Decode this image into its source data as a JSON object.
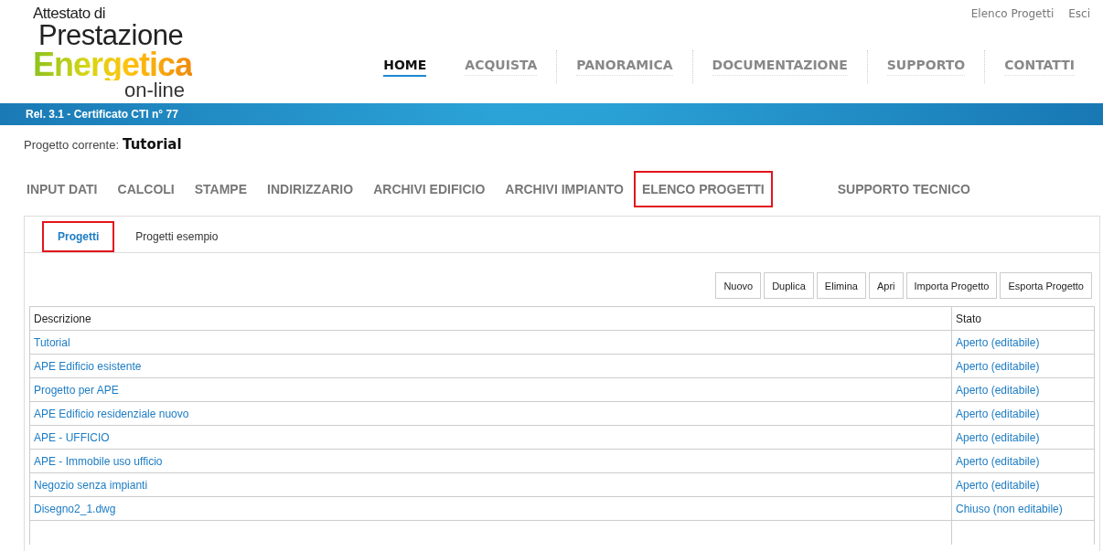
{
  "logo": {
    "line1": "Attestato di",
    "line2": "Prestazione",
    "line3": "Energetica",
    "line4": "on-line"
  },
  "top_links": [
    "Elenco Progetti",
    "Esci"
  ],
  "main_nav": [
    {
      "label": "HOME",
      "selected": true
    },
    {
      "label": "ACQUISTA",
      "selected": false
    },
    {
      "label": "PANORAMICA",
      "selected": false
    },
    {
      "label": "DOCUMENTAZIONE",
      "selected": false
    },
    {
      "label": "SUPPORTO",
      "selected": false
    },
    {
      "label": "CONTATTI",
      "selected": false
    }
  ],
  "release_bar": "Rel. 3.1 - Certificato CTI n° 77",
  "current_project": {
    "label": "Progetto corrente:",
    "value": "Tutorial"
  },
  "app_menu": [
    {
      "label": "INPUT DATI",
      "highlighted": false
    },
    {
      "label": "CALCOLI",
      "highlighted": false
    },
    {
      "label": "STAMPE",
      "highlighted": false
    },
    {
      "label": "INDIRIZZARIO",
      "highlighted": false
    },
    {
      "label": "ARCHIVI EDIFICIO",
      "highlighted": false
    },
    {
      "label": "ARCHIVI IMPIANTO",
      "highlighted": false
    },
    {
      "label": "ELENCO PROGETTI",
      "highlighted": true
    },
    {
      "label": "SUPPORTO TECNICO",
      "highlighted": false
    }
  ],
  "tabs": [
    {
      "label": "Progetti",
      "selected": true,
      "highlighted": true
    },
    {
      "label": "Progetti esempio",
      "selected": false,
      "highlighted": false
    }
  ],
  "buttons": [
    "Nuovo",
    "Duplica",
    "Elimina",
    "Apri",
    "Importa Progetto",
    "Esporta Progetto"
  ],
  "table": {
    "columns": [
      "Descrizione",
      "Stato"
    ],
    "rows": [
      [
        "Tutorial",
        "Aperto (editabile)"
      ],
      [
        "APE Edificio esistente",
        "Aperto (editabile)"
      ],
      [
        "Progetto per APE",
        "Aperto (editabile)"
      ],
      [
        "APE Edificio residenziale nuovo",
        "Aperto (editabile)"
      ],
      [
        "APE - UFFICIO",
        "Aperto (editabile)"
      ],
      [
        "APE - Immobile uso ufficio",
        "Aperto (editabile)"
      ],
      [
        "Negozio senza impianti",
        "Aperto (editabile)"
      ],
      [
        "Disegno2_1.dwg",
        "Chiuso (non editabile)"
      ]
    ]
  }
}
